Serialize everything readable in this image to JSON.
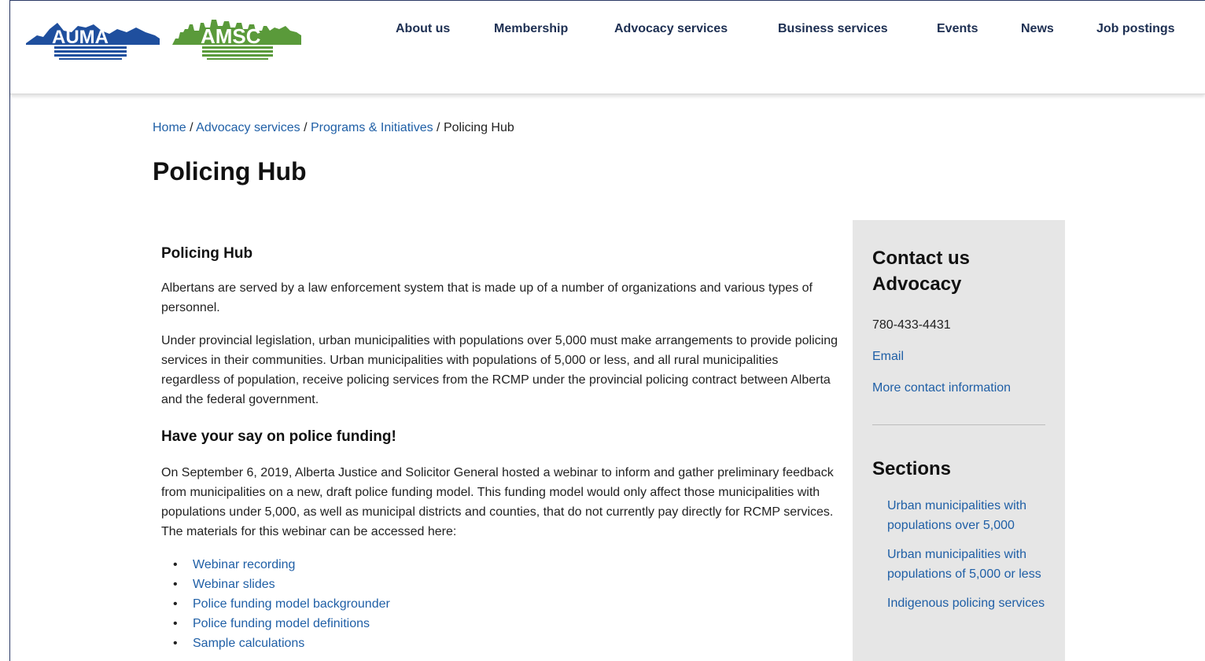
{
  "header": {
    "logo_auma": "AUMA",
    "logo_amsc": "AMSC",
    "colors": {
      "auma": "#1f4f9e",
      "amsc": "#5a9a3a",
      "nav_text": "#1d2f52"
    },
    "nav": [
      "About us",
      "Membership",
      "Advocacy services",
      "Business services",
      "Events",
      "News",
      "Job postings"
    ]
  },
  "breadcrumb": {
    "home": "Home",
    "advocacy": "Advocacy services",
    "programs": "Programs & Initiatives",
    "current": "Policing Hub",
    "separator": " / "
  },
  "page_title": "Policing Hub",
  "main": {
    "heading": "Policing Hub",
    "para1": "Albertans are served by a law enforcement system that is made up of a number of organizations and various types of personnel.",
    "para2": "Under provincial legislation, urban municipalities with populations over 5,000 must make arrangements to provide policing services in their communities. Urban municipalities with populations of 5,000 or less, and all rural municipalities regardless of population, receive policing services from the RCMP under the provincial policing contract between Alberta and the federal government.",
    "subheading": "Have your say on police funding!",
    "para3": "On September 6, 2019, Alberta Justice and Solicitor General hosted a webinar to inform and gather preliminary feedback from municipalities on a new, draft police funding model. This funding model would only affect those municipalities with populations under 5,000, as well as municipal districts and counties, that do not currently pay directly for RCMP services. The materials for this webinar can be accessed here:",
    "links": [
      "Webinar recording",
      "Webinar slides",
      "Police funding model backgrounder",
      "Police funding model definitions",
      "Sample calculations"
    ]
  },
  "sidebar": {
    "contact_title_1": "Contact us",
    "contact_title_2": "Advocacy",
    "phone": "780-433-4431",
    "email_label": "Email",
    "more_contact": "More contact information",
    "sections_title": "Sections",
    "sections": [
      "Urban municipalities with populations over 5,000",
      "Urban municipalities with populations of 5,000 or less",
      "Indigenous policing services"
    ]
  }
}
